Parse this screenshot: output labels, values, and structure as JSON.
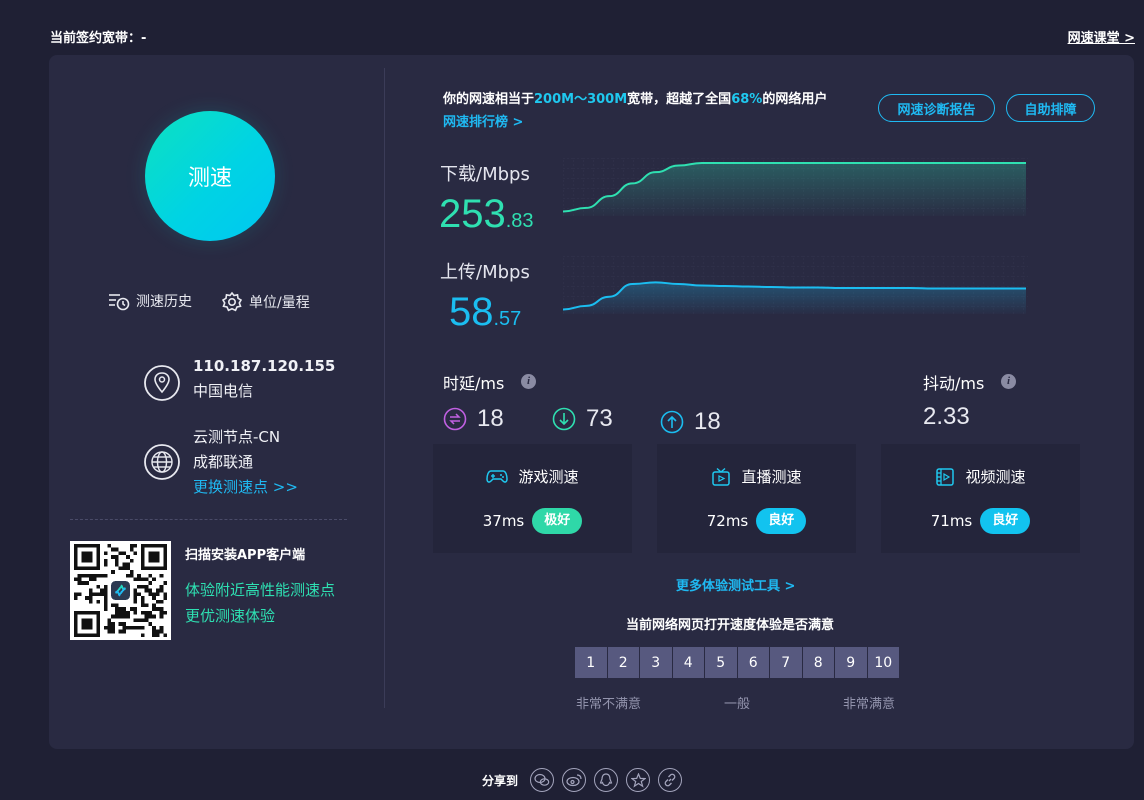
{
  "header": {
    "plan_label": "当前签约宽带：-",
    "course_link": "网速课堂 >"
  },
  "left": {
    "speed_button": "测速",
    "history_label": "测速历史",
    "unit_label": "单位/量程",
    "ip": "110.187.120.155",
    "isp": "中国电信",
    "node_name": "云测节点-CN",
    "node_isp": "成都联通",
    "change_node": "更换测速点 >>",
    "qr_title": "扫描安装APP客户端",
    "qr_line1": "体验附近高性能测速点",
    "qr_line2": "更优测速体验"
  },
  "summary": {
    "prefix": "你的网速相当于",
    "range": "200M～300M",
    "mid": "宽带，超越了全国",
    "percent": "68%",
    "suffix": "的网络用户",
    "rank_link": "网速排行榜 >"
  },
  "buttons": {
    "diagnose": "网速诊断报告",
    "self_help": "自助排障"
  },
  "download": {
    "label": "下载/Mbps",
    "int": "253",
    "dec": ".83",
    "color": "#2fe0b1",
    "profile": [
      0.05,
      0.12,
      0.35,
      0.6,
      0.82,
      0.95,
      1,
      1,
      1,
      1,
      1,
      1,
      1,
      1,
      1,
      1,
      1,
      1,
      1,
      1,
      1
    ]
  },
  "upload": {
    "label": "上传/Mbps",
    "int": "58",
    "dec": ".57",
    "color": "#1bbdf0",
    "profile": [
      0.05,
      0.12,
      0.3,
      0.55,
      0.58,
      0.55,
      0.52,
      0.51,
      0.5,
      0.49,
      0.48,
      0.48,
      0.47,
      0.47,
      0.47,
      0.47,
      0.46,
      0.46,
      0.46,
      0.46,
      0.46
    ]
  },
  "latency": {
    "label": "时延/ms",
    "avg": "18",
    "down": "73",
    "up": "18"
  },
  "jitter": {
    "label": "抖动/ms",
    "value": "2.33"
  },
  "cards": [
    {
      "title": "游戏测速",
      "value": "37ms",
      "badge": "极好",
      "badge_color": "#2fd8a8"
    },
    {
      "title": "直播测速",
      "value": "72ms",
      "badge": "良好",
      "badge_color": "#12c3ef"
    },
    {
      "title": "视频测速",
      "value": "71ms",
      "badge": "良好",
      "badge_color": "#12c3ef"
    }
  ],
  "more_tools": "更多体验测试工具 >",
  "survey": {
    "question": "当前网络网页打开速度体验是否满意",
    "scores": [
      "1",
      "2",
      "3",
      "4",
      "5",
      "6",
      "7",
      "8",
      "9",
      "10"
    ],
    "low": "非常不满意",
    "mid": "一般",
    "high": "非常满意"
  },
  "share": {
    "label": "分享到",
    "icons": [
      "wechat-icon",
      "weibo-icon",
      "qq-icon",
      "qzone-icon",
      "link-icon"
    ]
  }
}
